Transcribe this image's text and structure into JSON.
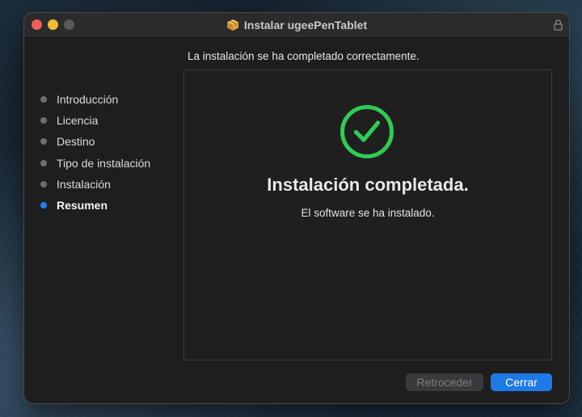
{
  "window": {
    "title": "Instalar ugeePenTablet",
    "icon": "package-icon",
    "lock_icon": "lock-icon"
  },
  "header": {
    "message": "La instalación se ha completado correctamente."
  },
  "sidebar": {
    "steps": [
      {
        "label": "Introducción",
        "active": false
      },
      {
        "label": "Licencia",
        "active": false
      },
      {
        "label": "Destino",
        "active": false
      },
      {
        "label": "Tipo de instalación",
        "active": false
      },
      {
        "label": "Instalación",
        "active": false
      },
      {
        "label": "Resumen",
        "active": true
      }
    ]
  },
  "content": {
    "icon": "checkmark-circle-icon",
    "title": "Instalación completada.",
    "subtitle": "El software se ha instalado."
  },
  "buttons": {
    "back_label": "Retroceder",
    "back_enabled": false,
    "close_label": "Cerrar"
  },
  "colors": {
    "accent": "#1c84f6",
    "success": "#2ecc55",
    "close_light": "#ee5f57",
    "minimize_light": "#f3bc2f"
  }
}
